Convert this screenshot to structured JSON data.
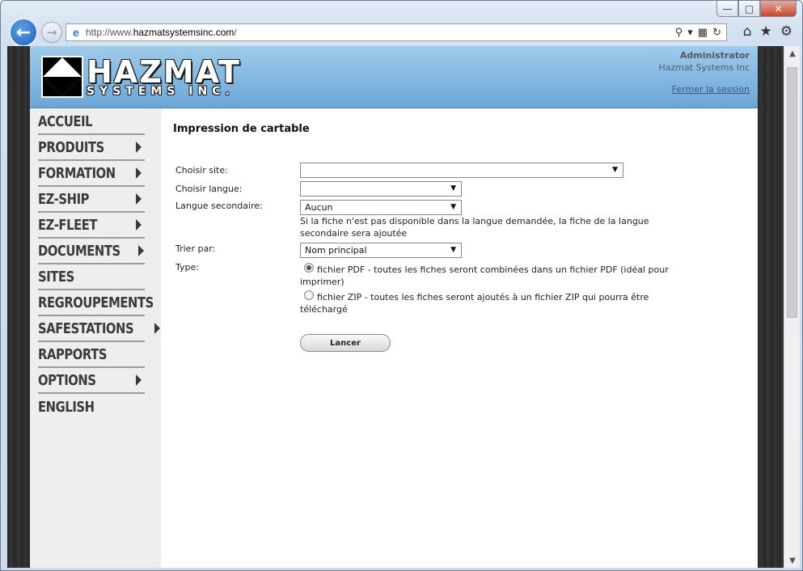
{
  "browser": {
    "url_prefix": "http://www.",
    "url_host": "hazmatsystemsinc.com",
    "url_suffix": "/",
    "window_controls": [
      "—",
      "□",
      "✕"
    ]
  },
  "header": {
    "logo_line1": "HAZMAT",
    "logo_line2": "SYSTEMS INC.",
    "user_name": "Administrator",
    "company": "Hazmat Systems Inc",
    "logout": "Fermer la session"
  },
  "sidebar": {
    "items": [
      {
        "label": "ACCUEIL",
        "submenu": false
      },
      {
        "label": "PRODUITS",
        "submenu": true
      },
      {
        "label": "FORMATION",
        "submenu": true
      },
      {
        "label": "EZ-SHIP",
        "submenu": true
      },
      {
        "label": "EZ-FLEET",
        "submenu": true
      },
      {
        "label": "DOCUMENTS",
        "submenu": true
      },
      {
        "label": "SITES",
        "submenu": false
      },
      {
        "label": "REGROUPEMENTS",
        "submenu": false
      },
      {
        "label": "SAFESTATIONS",
        "submenu": true
      },
      {
        "label": "RAPPORTS",
        "submenu": false
      },
      {
        "label": "OPTIONS",
        "submenu": true
      },
      {
        "label": "ENGLISH",
        "submenu": false
      }
    ]
  },
  "form": {
    "title": "Impression de cartable",
    "site_label": "Choisir site:",
    "site_value": "",
    "language_label": "Choisir langue:",
    "language_value": "",
    "secondary_label": "Langue secondaire:",
    "secondary_value": "Aucun",
    "secondary_hint_line1": "Si la fiche n'est pas disponible dans la langue demandée, la fiche de la langue",
    "secondary_hint_line2": "secondaire sera ajoutée",
    "sort_label": "Trier par:",
    "sort_value": "Nom principal",
    "type_label": "Type:",
    "pdf_option_line1": "fichier PDF - toutes les fiches seront combinées dans un fichier PDF (idéal pour",
    "pdf_option_line2": "imprimer)",
    "zip_option_line1": "fichier ZIP - toutes les fiches seront ajoutés à un fichier ZIP qui pourra être",
    "zip_option_line2": "téléchargé",
    "selected_type": "pdf",
    "submit_label": "Lancer"
  },
  "colors": {
    "header_top": "#9fcbea",
    "header_bottom": "#6aa7d8",
    "sidebar_bg": "#eeeeee",
    "nav_text": "#3a3a3a"
  }
}
